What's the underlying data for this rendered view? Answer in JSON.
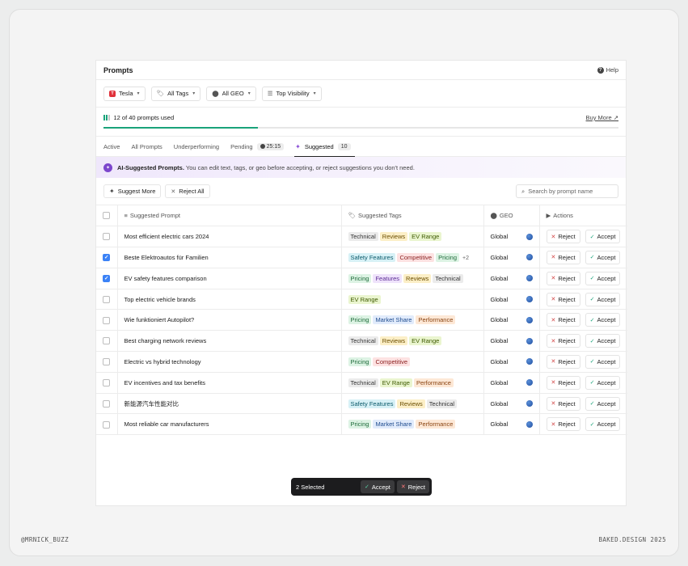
{
  "header": {
    "title": "Prompts",
    "help_label": "Help"
  },
  "filters": [
    {
      "label": "Tesla",
      "icon": "tesla-logo"
    },
    {
      "label": "All Tags",
      "icon": "tag-icon"
    },
    {
      "label": "All GEO",
      "icon": "pin-icon"
    },
    {
      "label": "Top Visibility",
      "icon": "sort-icon"
    }
  ],
  "usage": {
    "text": "12 of 40 prompts used",
    "used": 12,
    "total": 40,
    "buy_more": "Buy More ↗"
  },
  "tabs": [
    {
      "label": "Active"
    },
    {
      "label": "All Prompts"
    },
    {
      "label": "Underperforming"
    },
    {
      "label": "Pending",
      "badge": "25:15"
    },
    {
      "label": "Suggested",
      "badge": "10",
      "active": true
    }
  ],
  "banner": {
    "title": "AI-Suggested Prompts.",
    "text": "You can edit text, tags, or geo before accepting, or reject suggestions you don't need."
  },
  "toolbar": {
    "suggest_more": "Suggest More",
    "reject_all": "Reject All",
    "search_placeholder": "Search by prompt name"
  },
  "columns": {
    "prompt": "Suggested Prompt",
    "tags": "Suggested Tags",
    "geo": "GEO",
    "actions": "Actions"
  },
  "row_actions": {
    "reject": "Reject",
    "accept": "Accept"
  },
  "tag_colors": {
    "Technical": {
      "bg": "#ebebeb",
      "fg": "#333333"
    },
    "Reviews": {
      "bg": "#fcefc7",
      "fg": "#6b4e00"
    },
    "EV Range": {
      "bg": "#eaf5cf",
      "fg": "#3e5a00"
    },
    "Safety Features": {
      "bg": "#d7f1f6",
      "fg": "#0c5a6b"
    },
    "Competitive": {
      "bg": "#fde2e2",
      "fg": "#8a1f1f"
    },
    "Pricing": {
      "bg": "#ddf3e4",
      "fg": "#1e6b3a"
    },
    "Features": {
      "bg": "#efe3fb",
      "fg": "#5b2b94"
    },
    "Market Share": {
      "bg": "#e1ebfb",
      "fg": "#1f4c8f"
    },
    "Performance": {
      "bg": "#fde8d6",
      "fg": "#8a4412"
    }
  },
  "rows": [
    {
      "prompt": "Most efficient electric cars 2024",
      "tags": [
        "Technical",
        "Reviews",
        "EV Range"
      ],
      "more": "",
      "geo": "Global",
      "checked": false
    },
    {
      "prompt": "Beste Elektroautos für Familien",
      "tags": [
        "Safety Features",
        "Competitive",
        "Pricing"
      ],
      "more": "+2",
      "geo": "Global",
      "checked": true
    },
    {
      "prompt": "EV safety features comparison",
      "tags": [
        "Pricing",
        "Features",
        "Reviews",
        "Technical"
      ],
      "more": "",
      "geo": "Global",
      "checked": true
    },
    {
      "prompt": "Top electric vehicle brands",
      "tags": [
        "EV Range"
      ],
      "more": "",
      "geo": "Global",
      "checked": false
    },
    {
      "prompt": "Wie funktioniert Autopilot?",
      "tags": [
        "Pricing",
        "Market Share",
        "Performance"
      ],
      "more": "",
      "geo": "Global",
      "checked": false
    },
    {
      "prompt": "Best charging network reviews",
      "tags": [
        "Technical",
        "Reviews",
        "EV Range"
      ],
      "more": "",
      "geo": "Global",
      "checked": false
    },
    {
      "prompt": "Electric vs hybrid technology",
      "tags": [
        "Pricing",
        "Competitive"
      ],
      "more": "",
      "geo": "Global",
      "checked": false
    },
    {
      "prompt": "EV incentives and tax benefits",
      "tags": [
        "Technical",
        "EV Range",
        "Performance"
      ],
      "more": "",
      "geo": "Global",
      "checked": false
    },
    {
      "prompt": "新能源汽车性能对比",
      "tags": [
        "Safety Features",
        "Reviews",
        "Technical"
      ],
      "more": "",
      "geo": "Global",
      "checked": false
    },
    {
      "prompt": "Most reliable car manufacturers",
      "tags": [
        "Pricing",
        "Market Share",
        "Performance"
      ],
      "more": "",
      "geo": "Global",
      "checked": false
    }
  ],
  "selection": {
    "text": "2 Selected",
    "accept": "Accept",
    "reject": "Reject"
  },
  "footer": {
    "left": "@MRNICK_BUZZ",
    "right": "BAKED.DESIGN 2025"
  }
}
